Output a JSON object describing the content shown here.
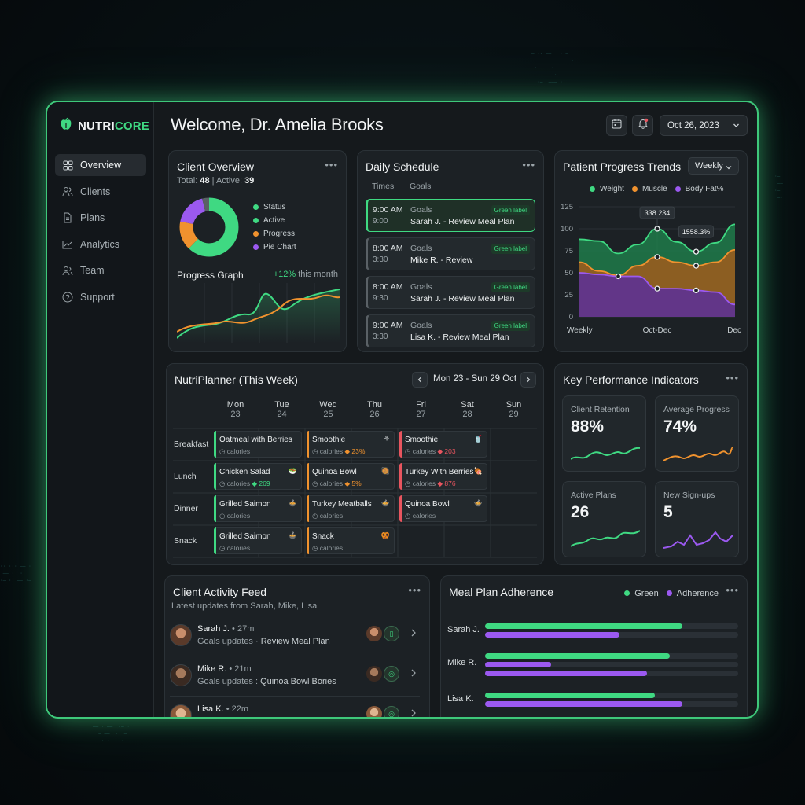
{
  "brand": {
    "name_prefix": "NUTRI",
    "name_suffix": "CORE",
    "accent": "#3fd982"
  },
  "sidebar": {
    "items": [
      {
        "label": "Overview",
        "icon": "grid-icon",
        "active": true
      },
      {
        "label": "Clients",
        "icon": "users-icon"
      },
      {
        "label": "Plans",
        "icon": "document-icon"
      },
      {
        "label": "Analytics",
        "icon": "chart-icon"
      },
      {
        "label": "Team",
        "icon": "team-icon"
      },
      {
        "label": "Support",
        "icon": "help-icon"
      }
    ]
  },
  "header": {
    "welcome": "Welcome, Dr. Amelia Brooks",
    "date": "Oct 26, 2023"
  },
  "client_overview": {
    "title": "Client Overview",
    "total_label": "Total:",
    "total": "48",
    "active_label": "Active:",
    "active": "39",
    "legend": [
      "Status",
      "Active",
      "Progress",
      "Pie Chart"
    ],
    "legend_colors": [
      "#3fd982",
      "#3fd982",
      "#f0922e",
      "#9b59f0"
    ],
    "donut": [
      {
        "value": 62,
        "color": "#3fd982"
      },
      {
        "value": 16,
        "color": "#f0922e"
      },
      {
        "value": 18,
        "color": "#9b59f0"
      },
      {
        "value": 4,
        "color": "#5a6166"
      }
    ],
    "progress_title": "Progress Graph",
    "progress_delta": "+12%",
    "progress_delta_suffix": "this month"
  },
  "daily_schedule": {
    "title": "Daily Schedule",
    "col_times": "Times",
    "col_goals": "Goals",
    "items": [
      {
        "time": "9:00 AM",
        "time2": "9:00",
        "goal": "Goals",
        "name": "Sarah J. - Review Meal Plan",
        "label": "Green label",
        "selected": true
      },
      {
        "time": "8:00 AM",
        "time2": "3:30",
        "goal": "Goals",
        "name": "Mike R. - Review",
        "label": "Green label"
      },
      {
        "time": "8:00 AM",
        "time2": "9:30",
        "goal": "Goals",
        "name": "Sarah J. - Review Meal Plan",
        "label": "Green label"
      },
      {
        "time": "9:00 AM",
        "time2": "3:30",
        "goal": "Goals",
        "name": "Lisa K. - Review Meal Plan",
        "label": "Green label"
      }
    ]
  },
  "patient_trends": {
    "title": "Patient Progress Trends",
    "period": "Weekly",
    "legend": [
      {
        "name": "Weight",
        "color": "#3fd982"
      },
      {
        "name": "Muscle",
        "color": "#f0922e"
      },
      {
        "name": "Body Fat%",
        "color": "#9b59f0"
      }
    ],
    "annotations": [
      "338.234",
      "1558.3%"
    ],
    "x_labels": [
      "Weekly",
      "Oct-Dec",
      "Dec"
    ]
  },
  "chart_data": {
    "type": "area",
    "title": "Patient Progress Trends",
    "x": [
      0,
      1,
      2,
      3,
      4,
      5,
      6,
      7,
      8
    ],
    "x_tick_labels": [
      "Weekly",
      "Oct-Dec",
      "Dec"
    ],
    "ylim": [
      0,
      125
    ],
    "y_ticks": [
      0,
      25,
      50,
      75,
      100,
      125
    ],
    "series": [
      {
        "name": "Weight",
        "values": [
          88,
          86,
          72,
          82,
          100,
          85,
          74,
          84,
          105
        ]
      },
      {
        "name": "Muscle",
        "values": [
          62,
          52,
          47,
          58,
          68,
          62,
          58,
          62,
          76
        ]
      },
      {
        "name": "Body Fat%",
        "values": [
          50,
          48,
          46,
          46,
          32,
          32,
          30,
          28,
          14
        ]
      }
    ],
    "legend": "top"
  },
  "planner": {
    "title": "NutriPlanner (This Week)",
    "range": "Mon 23 - Sun 29 Oct",
    "days": [
      {
        "d": "Mon",
        "n": "23"
      },
      {
        "d": "Tue",
        "n": "24"
      },
      {
        "d": "Wed",
        "n": "25"
      },
      {
        "d": "Thu",
        "n": "26"
      },
      {
        "d": "Fri",
        "n": "27"
      },
      {
        "d": "Sat",
        "n": "28"
      },
      {
        "d": "Sun",
        "n": "29"
      }
    ],
    "rows": [
      "Breakfast",
      "Lunch",
      "Dinner",
      "Snack"
    ],
    "meals": [
      {
        "row": 0,
        "col": 0,
        "name": "Oatmeal with Berries",
        "cal": "calories",
        "extra": "",
        "color": "#3fd982",
        "icon": ""
      },
      {
        "row": 0,
        "col": 2,
        "name": "Smoothie",
        "cal": "calories",
        "extra": "23%",
        "color": "#f0922e",
        "icon": "⚘"
      },
      {
        "row": 0,
        "col": 4,
        "name": "Smoothie",
        "cal": "calories",
        "extra": "203",
        "color": "#e8555f",
        "icon": "🥤"
      },
      {
        "row": 1,
        "col": 0,
        "name": "Chicken Salad",
        "cal": "calories",
        "extra": "269",
        "color": "#3fd982",
        "icon": "🥗"
      },
      {
        "row": 1,
        "col": 2,
        "name": "Quinoa Bowl",
        "cal": "calories",
        "extra": "5%",
        "color": "#f0922e",
        "icon": "🥘"
      },
      {
        "row": 1,
        "col": 4,
        "name": "Turkey With Berries",
        "cal": "calories",
        "extra": "876",
        "color": "#e8555f",
        "icon": "🍖"
      },
      {
        "row": 2,
        "col": 0,
        "name": "Grilled Saimon",
        "cal": "calories",
        "extra": "",
        "color": "#3fd982",
        "icon": "🍲"
      },
      {
        "row": 2,
        "col": 2,
        "name": "Turkey Meatballs",
        "cal": "calories",
        "extra": "",
        "color": "#f0922e",
        "icon": "🍲"
      },
      {
        "row": 2,
        "col": 4,
        "name": "Quinoa Bowl",
        "cal": "calories",
        "extra": "",
        "color": "#e8555f",
        "icon": "🍲"
      },
      {
        "row": 3,
        "col": 0,
        "name": "Grilled Saimon",
        "cal": "calories",
        "extra": "",
        "color": "#3fd982",
        "icon": "🍲"
      },
      {
        "row": 3,
        "col": 2,
        "name": "Snack",
        "cal": "calories",
        "extra": "",
        "color": "#f0922e",
        "icon": "🥨"
      }
    ]
  },
  "kpis": {
    "title": "Key Performance Indicators",
    "items": [
      {
        "label": "Client Retention",
        "value": "88%",
        "color": "#3fd982"
      },
      {
        "label": "Average Progress",
        "value": "74%",
        "color": "#f0922e"
      },
      {
        "label": "Active Plans",
        "value": "26",
        "color": "#3fd982"
      },
      {
        "label": "New Sign-ups",
        "value": "5",
        "color": "#9b59f0"
      }
    ]
  },
  "activity": {
    "title": "Client Activity Feed",
    "subtitle": "Latest updates from Sarah, Mike, Lisa",
    "items": [
      {
        "name": "Sarah J.",
        "time": "27m",
        "prefix": "Goals updates · ",
        "detail": "Review Meal Plan",
        "icon": "clipboard-icon"
      },
      {
        "name": "Mike R.",
        "time": "21m",
        "prefix": "Goals updates : ",
        "detail": "Quinoa Bowl Bories",
        "icon": "target-icon"
      },
      {
        "name": "Lisa K.",
        "time": "22m",
        "prefix": "Goals updates · ",
        "detail": "Review Meal Plan",
        "icon": "target-icon"
      }
    ]
  },
  "adherence": {
    "title": "Meal Plan Adherence",
    "legend": [
      {
        "name": "Green",
        "color": "#3fd982"
      },
      {
        "name": "Adherence",
        "color": "#9b59f0"
      }
    ],
    "rows": [
      {
        "name": "Sarah J.",
        "green": 0.78,
        "purple": 0.53
      },
      {
        "name": "Mike R.",
        "green": 0.73,
        "purple": 0.26,
        "purple2": 0.64
      },
      {
        "name": "Lisa K.",
        "green": 0.67,
        "purple": 0.78
      }
    ]
  }
}
